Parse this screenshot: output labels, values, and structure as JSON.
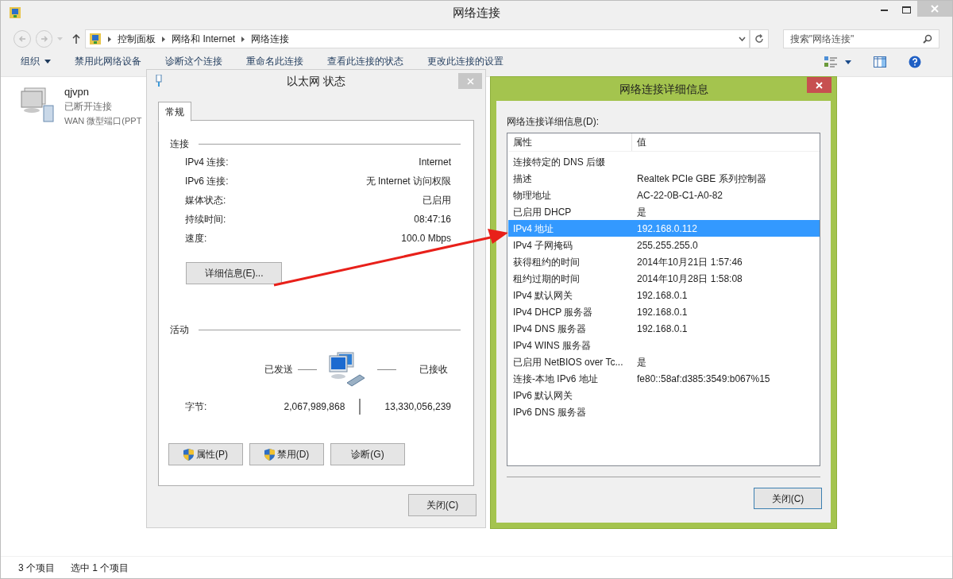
{
  "window": {
    "title": "网络连接"
  },
  "address_bar": {
    "breadcrumbs": [
      "控制面板",
      "网络和 Internet",
      "网络连接"
    ]
  },
  "search": {
    "placeholder": "搜索\"网络连接\""
  },
  "toolbar": {
    "items": [
      {
        "label": "组织",
        "dropdown": true
      },
      {
        "label": "禁用此网络设备",
        "dropdown": false
      },
      {
        "label": "诊断这个连接",
        "dropdown": false
      },
      {
        "label": "重命名此连接",
        "dropdown": false
      },
      {
        "label": "查看此连接的状态",
        "dropdown": false
      },
      {
        "label": "更改此连接的设置",
        "dropdown": false
      }
    ]
  },
  "items": [
    {
      "name": "qjvpn",
      "status": "已断开连接",
      "device": "WAN 微型端口(PPT"
    }
  ],
  "status_bar": [
    "3 个项目",
    "选中 1 个项目"
  ],
  "status_dialog": {
    "title": "以太网 状态",
    "tabs": [
      {
        "label": "常规",
        "selected": true
      }
    ],
    "connection": {
      "heading": "连接",
      "rows": [
        {
          "label": "IPv4 连接:",
          "value": "Internet"
        },
        {
          "label": "IPv6 连接:",
          "value": "无 Internet 访问权限"
        },
        {
          "label": "媒体状态:",
          "value": "已启用"
        },
        {
          "label": "持续时间:",
          "value": "08:47:16"
        },
        {
          "label": "速度:",
          "value": "100.0 Mbps"
        }
      ]
    },
    "details_button": "详细信息(E)...",
    "activity": {
      "heading": "活动",
      "sent_label": "已发送",
      "received_label": "已接收",
      "bytes_label": "字节:",
      "sent": "2,067,989,868",
      "received": "13,330,056,239"
    },
    "buttons": [
      {
        "label": "属性(P)",
        "kind": "shield"
      },
      {
        "label": "禁用(D)",
        "kind": "shield"
      },
      {
        "label": "诊断(G)",
        "kind": "plain"
      }
    ],
    "close_button": "关闭(C)"
  },
  "details_dialog": {
    "title": "网络连接详细信息",
    "list_label": "网络连接详细信息(D):",
    "columns": [
      "属性",
      "值"
    ],
    "rows": [
      {
        "property": "连接特定的 DNS 后缀",
        "value": "",
        "selected": false
      },
      {
        "property": "描述",
        "value": "Realtek PCIe GBE 系列控制器",
        "selected": false
      },
      {
        "property": "物理地址",
        "value": "AC-22-0B-C1-A0-82",
        "selected": false
      },
      {
        "property": "已启用 DHCP",
        "value": "是",
        "selected": false
      },
      {
        "property": "IPv4 地址",
        "value": "192.168.0.112",
        "selected": true
      },
      {
        "property": "IPv4 子网掩码",
        "value": "255.255.255.0",
        "selected": false
      },
      {
        "property": "获得租约的时间",
        "value": "2014年10月21日 1:57:46",
        "selected": false
      },
      {
        "property": "租约过期的时间",
        "value": "2014年10月28日 1:58:08",
        "selected": false
      },
      {
        "property": "IPv4 默认网关",
        "value": "192.168.0.1",
        "selected": false
      },
      {
        "property": "IPv4 DHCP 服务器",
        "value": "192.168.0.1",
        "selected": false
      },
      {
        "property": "IPv4 DNS 服务器",
        "value": "192.168.0.1",
        "selected": false
      },
      {
        "property": "IPv4 WINS 服务器",
        "value": "",
        "selected": false
      },
      {
        "property": "已启用 NetBIOS over Tc...",
        "value": "是",
        "selected": false
      },
      {
        "property": "连接-本地 IPv6 地址",
        "value": "fe80::58af:d385:3549:b067%15",
        "selected": false
      },
      {
        "property": "IPv6 默认网关",
        "value": "",
        "selected": false
      },
      {
        "property": "IPv6 DNS 服务器",
        "value": "",
        "selected": false
      }
    ],
    "close_button": "关闭(C)"
  }
}
